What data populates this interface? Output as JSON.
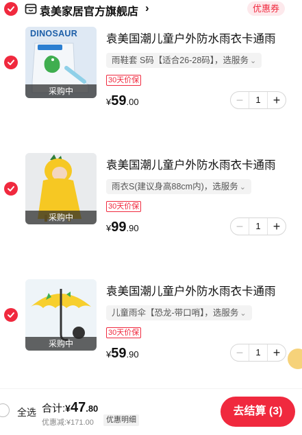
{
  "shop": {
    "name": "袁美家居官方旗舰店",
    "chevron": "›",
    "coupon_label": "优惠券"
  },
  "items": [
    {
      "title": "袁美国潮儿童户外防水雨衣卡通雨",
      "spec": "雨鞋套 S码【适合26-28码】，选服务",
      "tag": "30天价保",
      "price_currency": "¥",
      "price_int": "59",
      "price_dec": ".00",
      "quantity": "1",
      "status": "采购中",
      "image_text": "DINOSAUR"
    },
    {
      "title": "袁美国潮儿童户外防水雨衣卡通雨",
      "spec": "雨衣S(建议身高88cm内)，选服务",
      "tag": "30天价保",
      "price_currency": "¥",
      "price_int": "99",
      "price_dec": ".90",
      "quantity": "1",
      "status": "采购中"
    },
    {
      "title": "袁美国潮儿童户外防水雨衣卡通雨",
      "spec": "儿童雨伞【恐龙-带口哨】，选服务",
      "tag": "30天价保",
      "price_currency": "¥",
      "price_int": "59",
      "price_dec": ".90",
      "quantity": "1",
      "status": "采购中"
    }
  ],
  "stepper": {
    "minus": "−",
    "plus": "+"
  },
  "spec_chevron": "⌄",
  "footer": {
    "select_all": "全选",
    "total_label": "合计:",
    "total_currency": "¥",
    "total_int": "47",
    "total_dec": ".80",
    "discount": "优惠减:¥171.00",
    "detail_link": "优惠明细",
    "checkout": "去结算 (3)"
  },
  "colors": {
    "accent": "#f0293e",
    "coupon_bg": "#fde9ec"
  },
  "icons": [
    "check-icon",
    "store-icon",
    "chevron-right-icon",
    "chevron-down-icon",
    "minus-icon",
    "plus-icon",
    "radio-icon"
  ]
}
